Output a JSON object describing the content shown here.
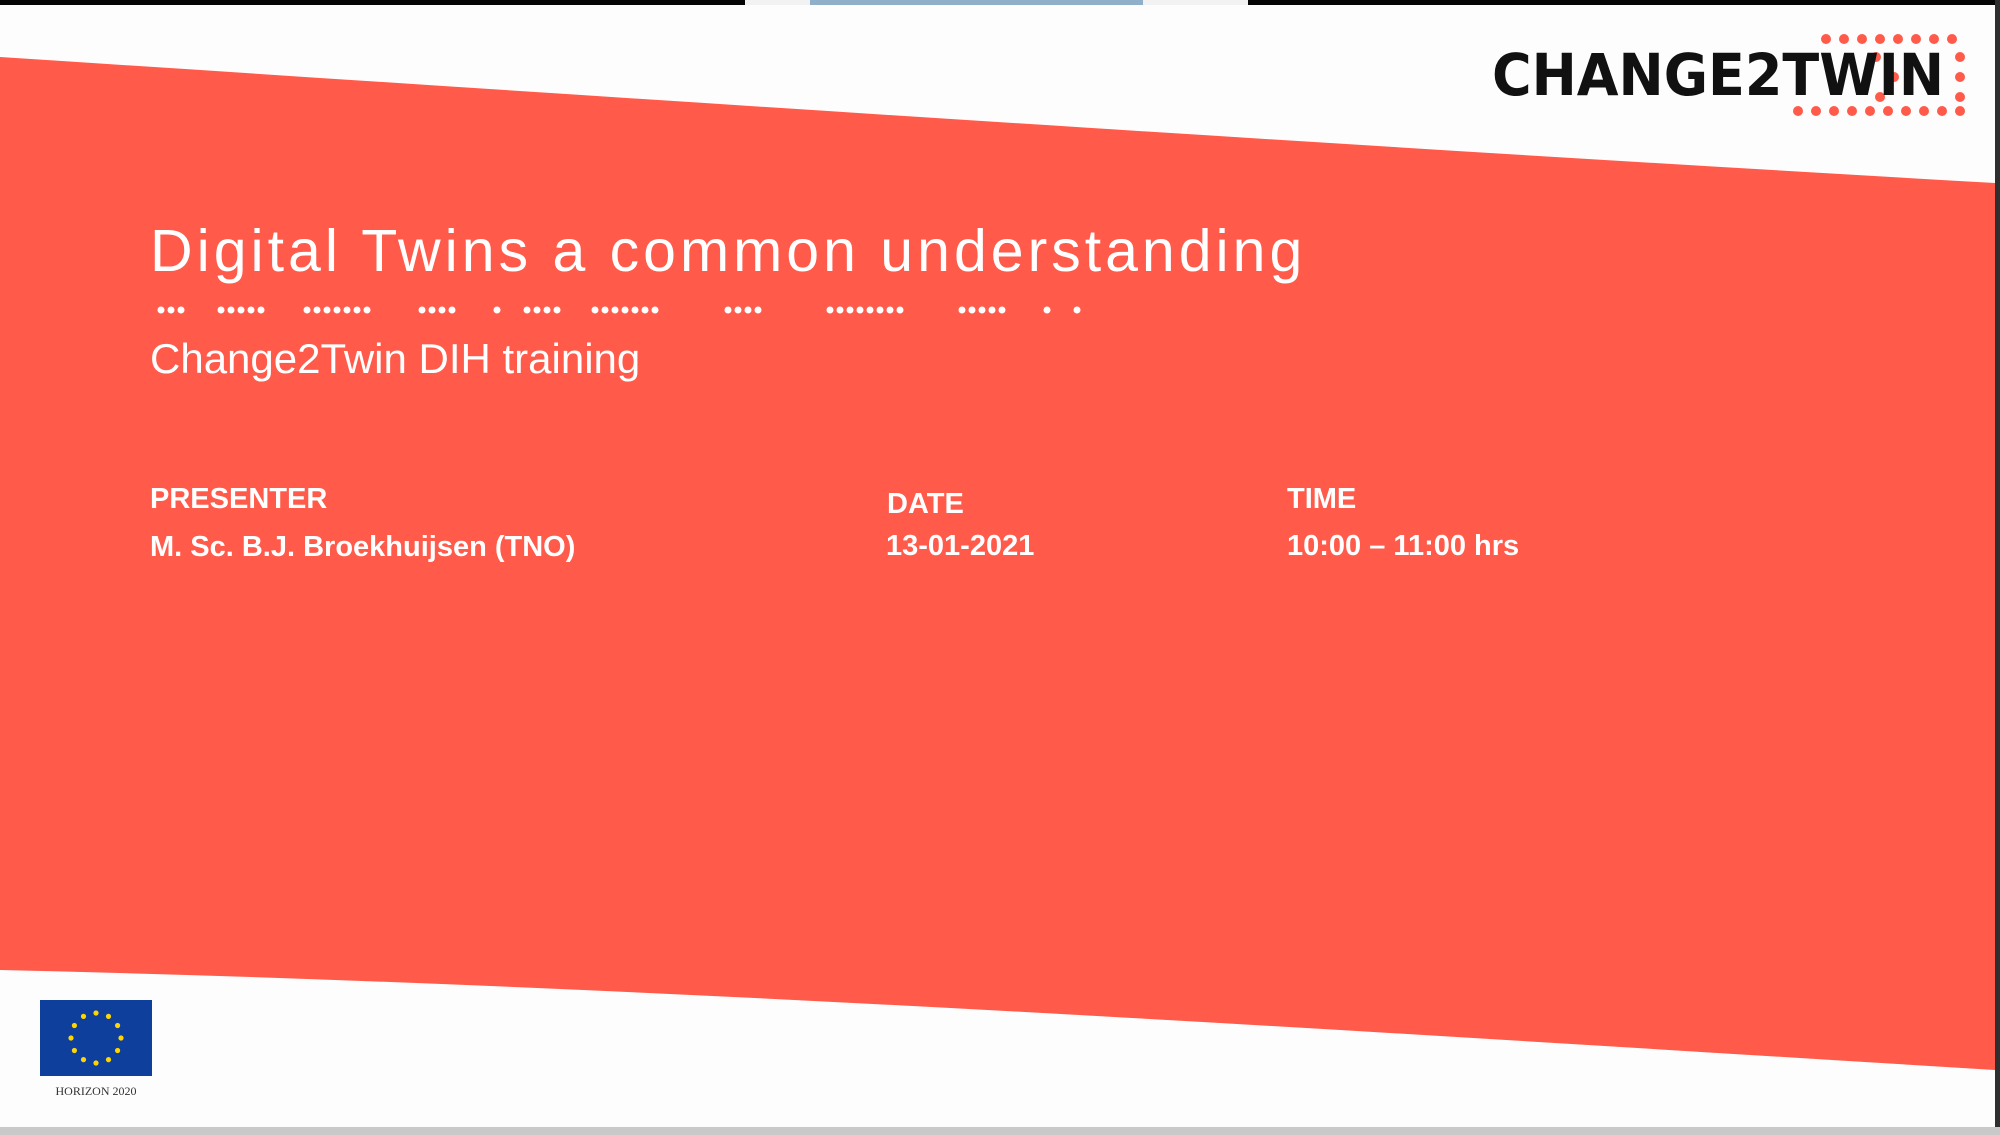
{
  "slide": {
    "title": "Digital Twins a common understanding",
    "subtitle": "Change2Twin DIH training",
    "presenter_label": "PRESENTER",
    "presenter_value": "M. Sc. B.J. Broekhuijsen (TNO)",
    "date_label": "DATE",
    "date_value": "13-01-2021",
    "time_label": "TIME",
    "time_value": "10:00 – 11:00 hrs"
  },
  "logo": {
    "text": "CHANGE2TWIN",
    "icon": "change2twin-logo"
  },
  "footer": {
    "eu_caption": "HORIZON 2020",
    "icon": "eu-flag-icon"
  },
  "colors": {
    "accent": "#ff5a4a",
    "slide_background": "#fdfdfd",
    "logo_text": "#111111",
    "eu_blue": "#0f3f9c",
    "eu_star": "#ffd500"
  }
}
